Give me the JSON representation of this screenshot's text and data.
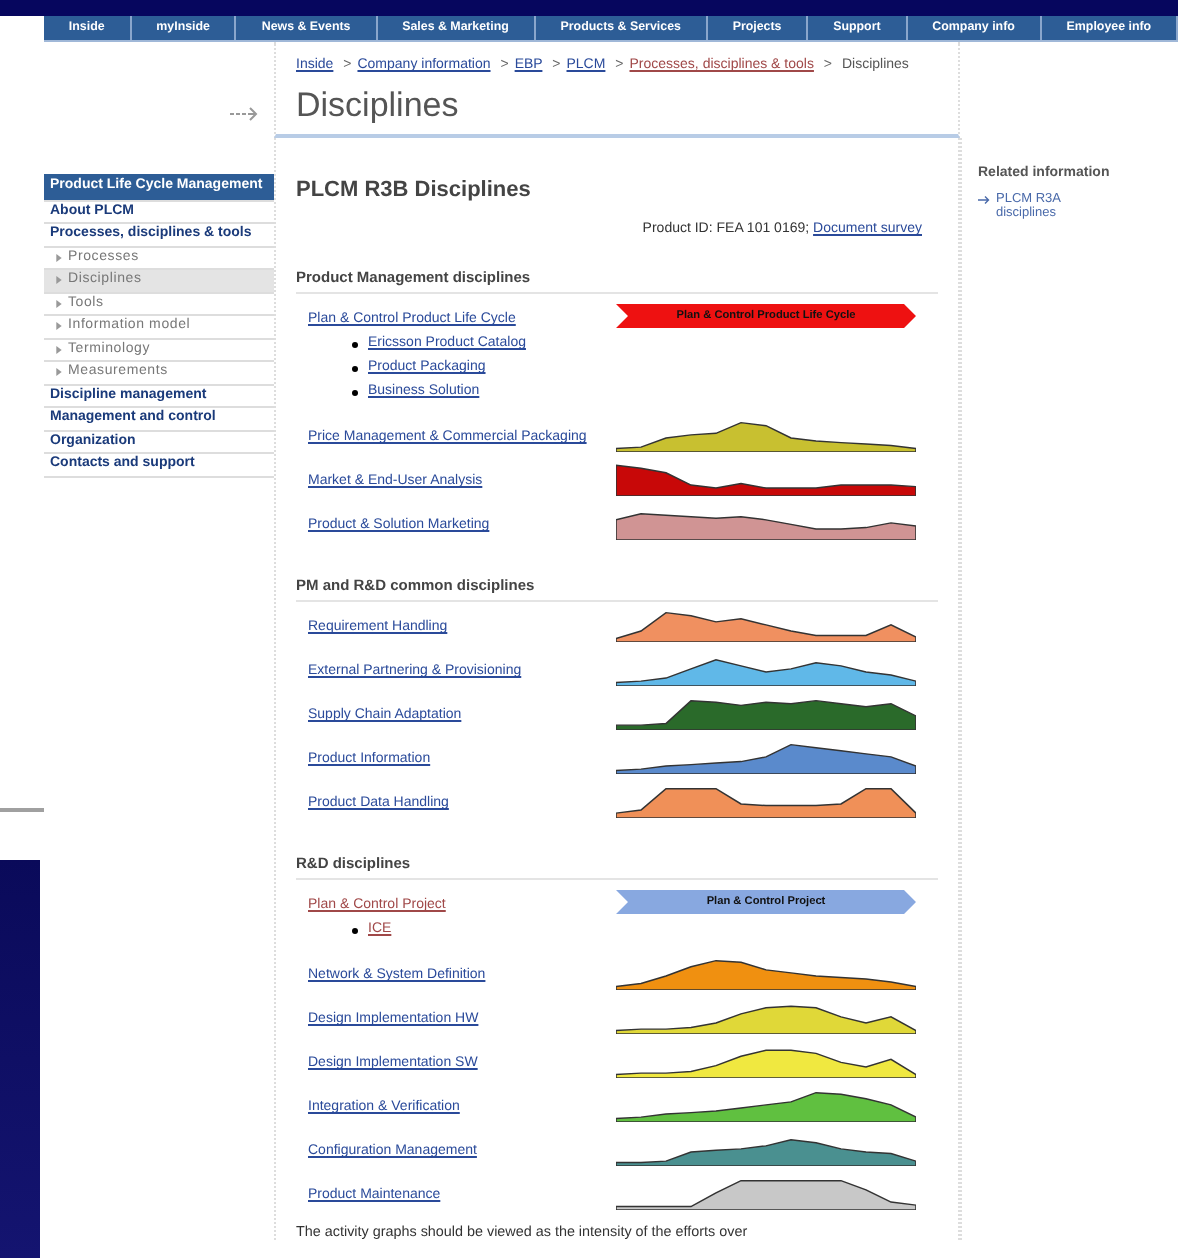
{
  "nav": [
    {
      "label": "Inside"
    },
    {
      "label": "myInside"
    },
    {
      "label": "News & Events"
    },
    {
      "label": "Sales & Marketing"
    },
    {
      "label": "Products & Services"
    },
    {
      "label": "Projects"
    },
    {
      "label": "Support"
    },
    {
      "label": "Company info"
    },
    {
      "label": "Employee info"
    }
  ],
  "breadcrumb": {
    "separator": ">",
    "links": [
      {
        "label": "Inside",
        "visited": false
      },
      {
        "label": "Company information",
        "visited": false
      },
      {
        "label": "EBP",
        "visited": false
      },
      {
        "label": "PLCM",
        "visited": false
      },
      {
        "label": "Processes, disciplines & tools",
        "visited": true
      }
    ],
    "current": "Disciplines"
  },
  "page_title": "Disciplines",
  "sidebar": {
    "items": [
      {
        "label": "Product Life Cycle Management",
        "kind": "heading",
        "selected": false
      },
      {
        "label": "About PLCM",
        "kind": "main",
        "selected": false
      },
      {
        "label": "Processes, disciplines & tools",
        "kind": "main",
        "selected": false
      },
      {
        "label": "Processes",
        "kind": "sub",
        "selected": false
      },
      {
        "label": "Disciplines",
        "kind": "sub",
        "selected": true
      },
      {
        "label": "Tools",
        "kind": "sub",
        "selected": false
      },
      {
        "label": "Information model",
        "kind": "sub",
        "selected": false
      },
      {
        "label": "Terminology",
        "kind": "sub",
        "selected": false
      },
      {
        "label": "Measurements",
        "kind": "sub",
        "selected": false
      },
      {
        "label": "Discipline management",
        "kind": "main",
        "selected": false
      },
      {
        "label": "Management and control",
        "kind": "main",
        "selected": false
      },
      {
        "label": "Organization",
        "kind": "main",
        "selected": false
      },
      {
        "label": "Contacts and support",
        "kind": "main",
        "selected": false
      }
    ]
  },
  "content": {
    "title": "PLCM R3B Disciplines",
    "product_id": "Product ID: FEA 101 0169;",
    "survey_link": "Document survey",
    "sections": [
      {
        "title": "Product Management disciplines",
        "rows": [
          {
            "label": "Plan & Control Product Life Cycle",
            "visited": false,
            "graph": {
              "kind": "banner",
              "label": "Plan & Control Product Life Cycle",
              "color": "#ee1111"
            },
            "bullets": [
              {
                "label": "Ericsson Product Catalog",
                "visited": false
              },
              {
                "label": "Product Packaging",
                "visited": false
              },
              {
                "label": "Business Solution",
                "visited": false
              }
            ]
          },
          {
            "label": "Price Management & Commercial Packaging",
            "visited": false,
            "graph": {
              "kind": "curve",
              "color": "#c8c030"
            }
          },
          {
            "label": "Market & End-User Analysis",
            "visited": false,
            "graph": {
              "kind": "curve",
              "color": "#c80808"
            }
          },
          {
            "label": "Product & Solution Marketing",
            "visited": false,
            "graph": {
              "kind": "curve",
              "color": "#d09494"
            }
          }
        ]
      },
      {
        "title": "PM and R&D common disciplines",
        "rows": [
          {
            "label": "Requirement Handling",
            "visited": false,
            "graph": {
              "kind": "curve",
              "color": "#f09060"
            }
          },
          {
            "label": "External Partnering & Provisioning",
            "visited": false,
            "graph": {
              "kind": "curve",
              "color": "#60b8e8"
            }
          },
          {
            "label": "Supply Chain Adaptation",
            "visited": false,
            "graph": {
              "kind": "curve",
              "color": "#2a6a2a"
            }
          },
          {
            "label": "Product Information",
            "visited": false,
            "graph": {
              "kind": "curve",
              "color": "#5a8acc"
            }
          },
          {
            "label": "Product Data Handling",
            "visited": false,
            "graph": {
              "kind": "curve",
              "color": "#f09058"
            }
          }
        ]
      },
      {
        "title": "R&D disciplines",
        "rows": [
          {
            "label": "Plan & Control Project",
            "visited": true,
            "graph": {
              "kind": "banner",
              "label": "Plan & Control Project",
              "color": "#88a8e0"
            },
            "bullets": [
              {
                "label": "ICE",
                "visited": true
              }
            ]
          },
          {
            "label": "Network & System Definition",
            "visited": false,
            "graph": {
              "kind": "curve",
              "color": "#f09010"
            }
          },
          {
            "label": "Design Implementation HW",
            "visited": false,
            "graph": {
              "kind": "curve",
              "color": "#e0d838"
            }
          },
          {
            "label": "Design Implementation SW",
            "visited": false,
            "graph": {
              "kind": "curve",
              "color": "#f0e840"
            }
          },
          {
            "label": "Integration & Verification",
            "visited": false,
            "graph": {
              "kind": "curve",
              "color": "#60c040"
            }
          },
          {
            "label": "Configuration Management",
            "visited": false,
            "graph": {
              "kind": "curve",
              "color": "#4a9090"
            }
          },
          {
            "label": "Product Maintenance",
            "visited": false,
            "graph": {
              "kind": "curve",
              "color": "#c8c8c8"
            }
          }
        ]
      }
    ],
    "note": "The activity graphs should be viewed as the intensity of the efforts over"
  },
  "related": {
    "title": "Related information",
    "links": [
      {
        "label": "PLCM R3A disciplines",
        "visited": false
      }
    ]
  }
}
